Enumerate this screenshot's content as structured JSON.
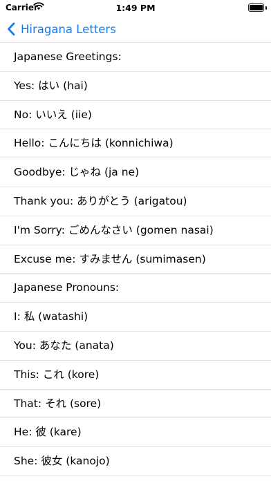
{
  "status_bar": {
    "carrier": "Carrier",
    "time": "1:49 PM"
  },
  "nav": {
    "back_label": "Hiragana Letters"
  },
  "colors": {
    "accent": "#1a7de6",
    "separator": "#e3e3e6"
  },
  "list": {
    "items": [
      "Japanese Greetings:",
      "Yes: はい (hai)",
      "No: いいえ (iie)",
      "Hello: こんにちは (konnichiwa)",
      "Goodbye: じゃね (ja ne)",
      "Thank you: ありがとう (arigatou)",
      "I'm Sorry: ごめんなさい (gomen nasai)",
      "Excuse me: すみません (sumimasen)",
      "Japanese Pronouns:",
      "I: 私 (watashi)",
      "You: あなた (anata)",
      "This: これ (kore)",
      "That: それ (sore)",
      "He: 彼 (kare)",
      "She: 彼女 (kanojo)"
    ]
  }
}
